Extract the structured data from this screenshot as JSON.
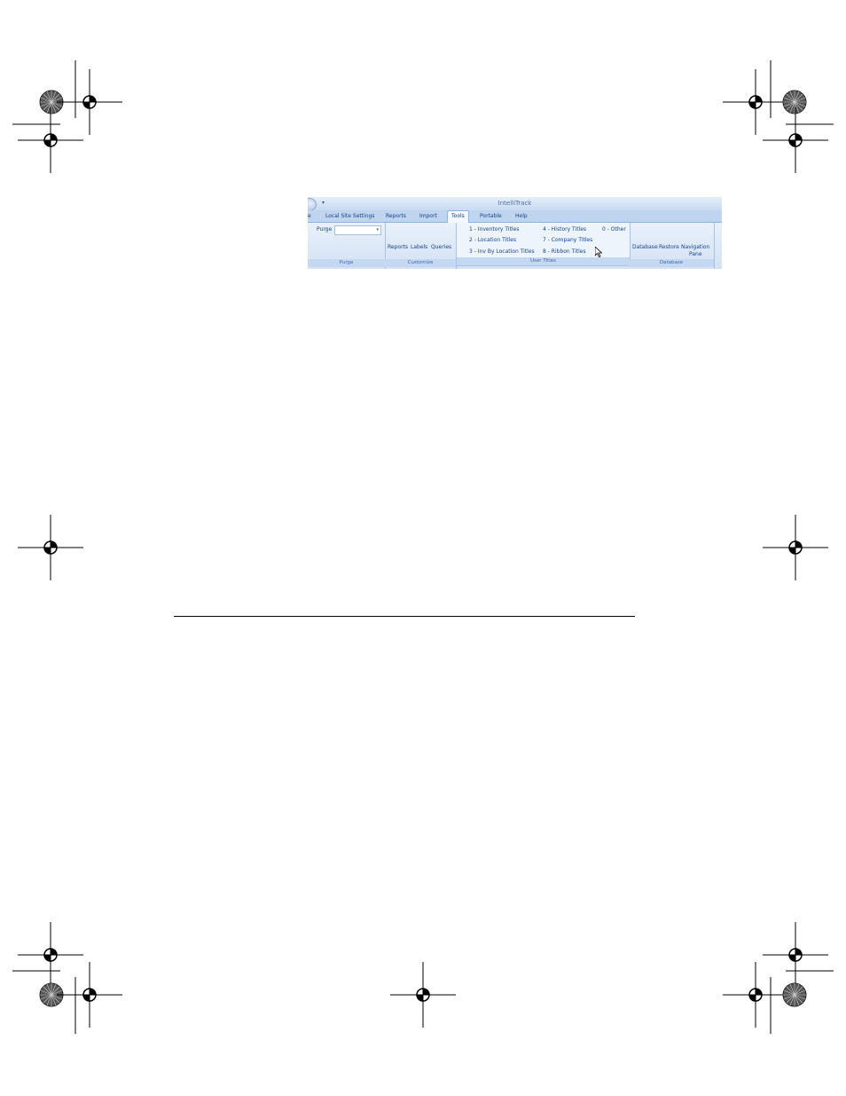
{
  "ribbon": {
    "app_title": "IntelliTrack",
    "qat_arrow": "▾",
    "tabs": {
      "partial": "e",
      "local_site_settings": "Local Site Settings",
      "reports": "Reports",
      "import": "Import",
      "tools": "Tools",
      "portable": "Portable",
      "help": "Help"
    },
    "purge": {
      "label": "Purge",
      "dropdown_arrow": "▾",
      "group_label": "Purge"
    },
    "customize": {
      "reports": "Reports",
      "labels": "Labels",
      "queries": "Queries",
      "group_label": "Customize"
    },
    "user_titles": {
      "item1": "1 - Inventory Titles",
      "item2": "2 - Location Titles",
      "item3": "3 - Inv By Location Titles",
      "item4": "4 - History Titles",
      "item7": "7 - Company Titles",
      "item8": "8 - Ribbon Titles",
      "item0": "0 - Other",
      "group_label": "User Titles"
    },
    "database": {
      "database": "Database",
      "restore": "Restore",
      "navigation_line1": "Navigation",
      "navigation_line2": "Pane",
      "group_label": "Database"
    }
  },
  "icons": [
    "registration-mark-icon",
    "starburst-target-icon",
    "mouse-pointer-icon"
  ],
  "colors": {
    "ribbon_bg": "#dbe7f6",
    "ribbon_text": "#15428b"
  }
}
